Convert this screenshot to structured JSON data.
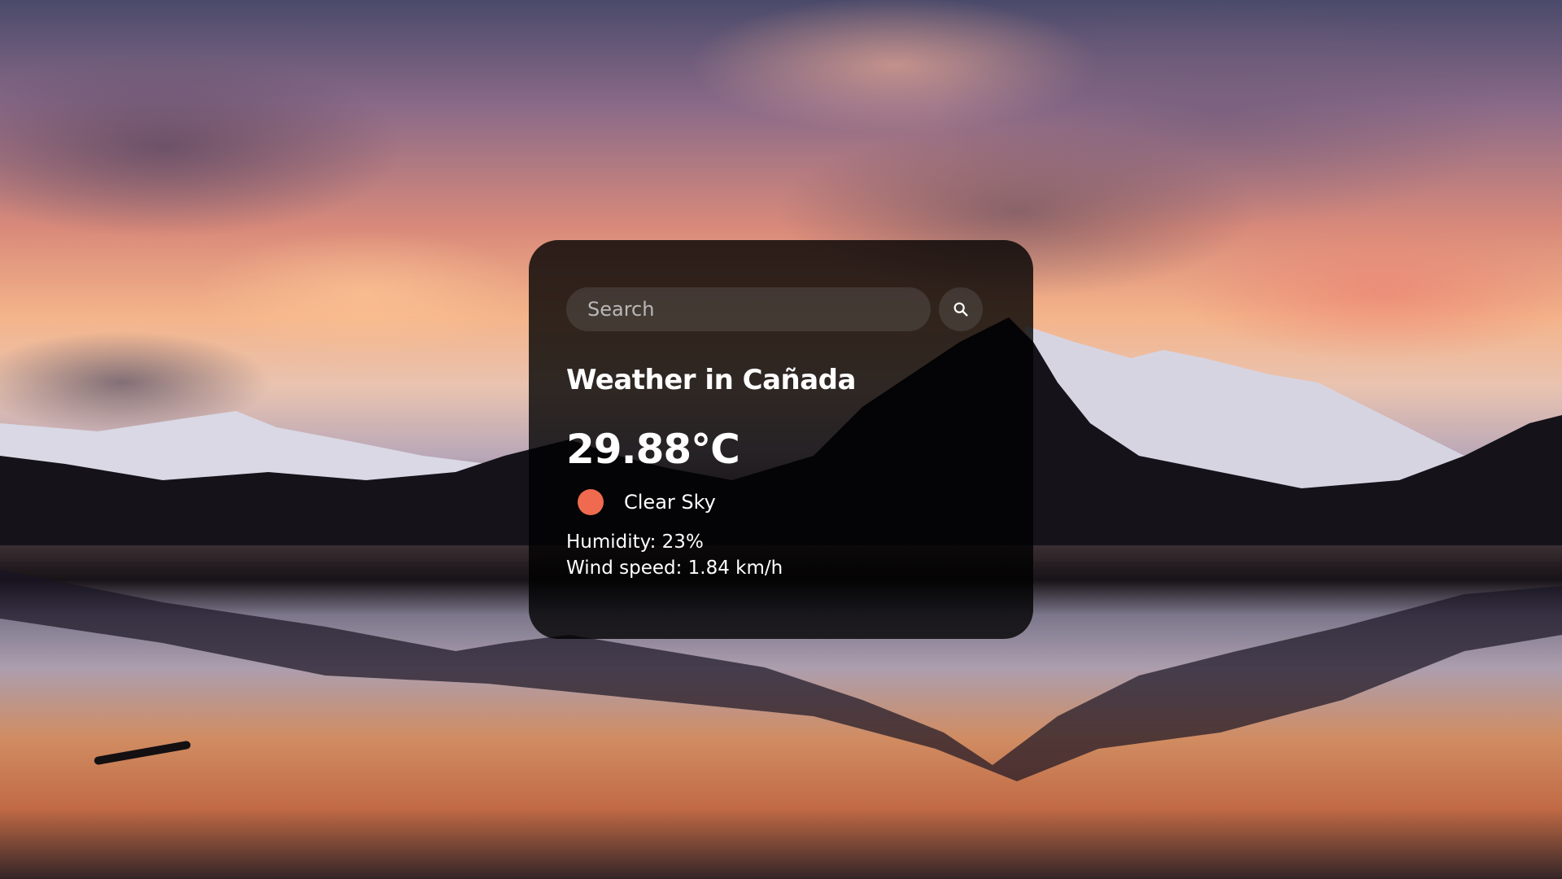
{
  "search": {
    "placeholder": "Search",
    "value": "",
    "button_icon": "search-icon"
  },
  "weather": {
    "title": "Weather in Cañada",
    "temperature": "29.88°C",
    "icon": "sun-icon",
    "icon_color": "#f06a4f",
    "description": "Clear Sky",
    "humidity": "Humidity: 23%",
    "wind": "Wind speed: 1.84 km/h"
  },
  "colors": {
    "card_background": "rgba(0,0,0,0.8)",
    "text": "#ffffff"
  }
}
